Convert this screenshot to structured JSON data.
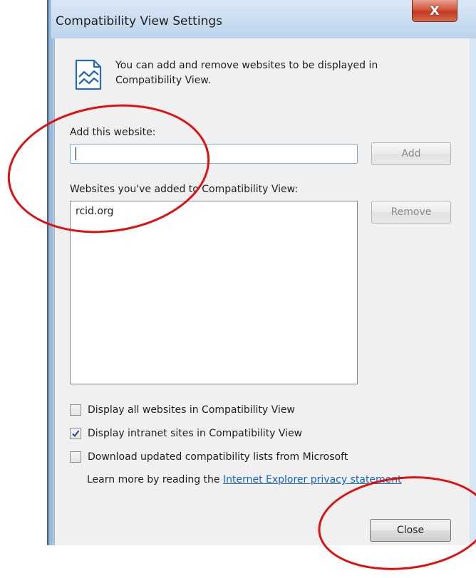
{
  "window": {
    "title": "Compatibility View Settings",
    "close_glyph": "X"
  },
  "info": {
    "icon": "compatibility-view-icon",
    "text": "You can add and remove websites to be displayed in Compatibility View."
  },
  "add_website": {
    "label": "Add this website:",
    "value": "",
    "add_button": "Add"
  },
  "sites": {
    "label": "Websites you've added to Compatibility View:",
    "items": [
      "rcid.org"
    ],
    "remove_button": "Remove"
  },
  "options": [
    {
      "label": "Display all websites in Compatibility View",
      "checked": false
    },
    {
      "label": "Display intranet sites in Compatibility View",
      "checked": true
    },
    {
      "label": "Download updated compatibility lists from Microsoft",
      "checked": false
    }
  ],
  "learn_more": {
    "prefix": "Learn more by reading the ",
    "link_text": "Internet Explorer privacy statement"
  },
  "footer": {
    "close_button": "Close"
  },
  "colors": {
    "annotation": "#e01010",
    "link": "#1565c0"
  }
}
